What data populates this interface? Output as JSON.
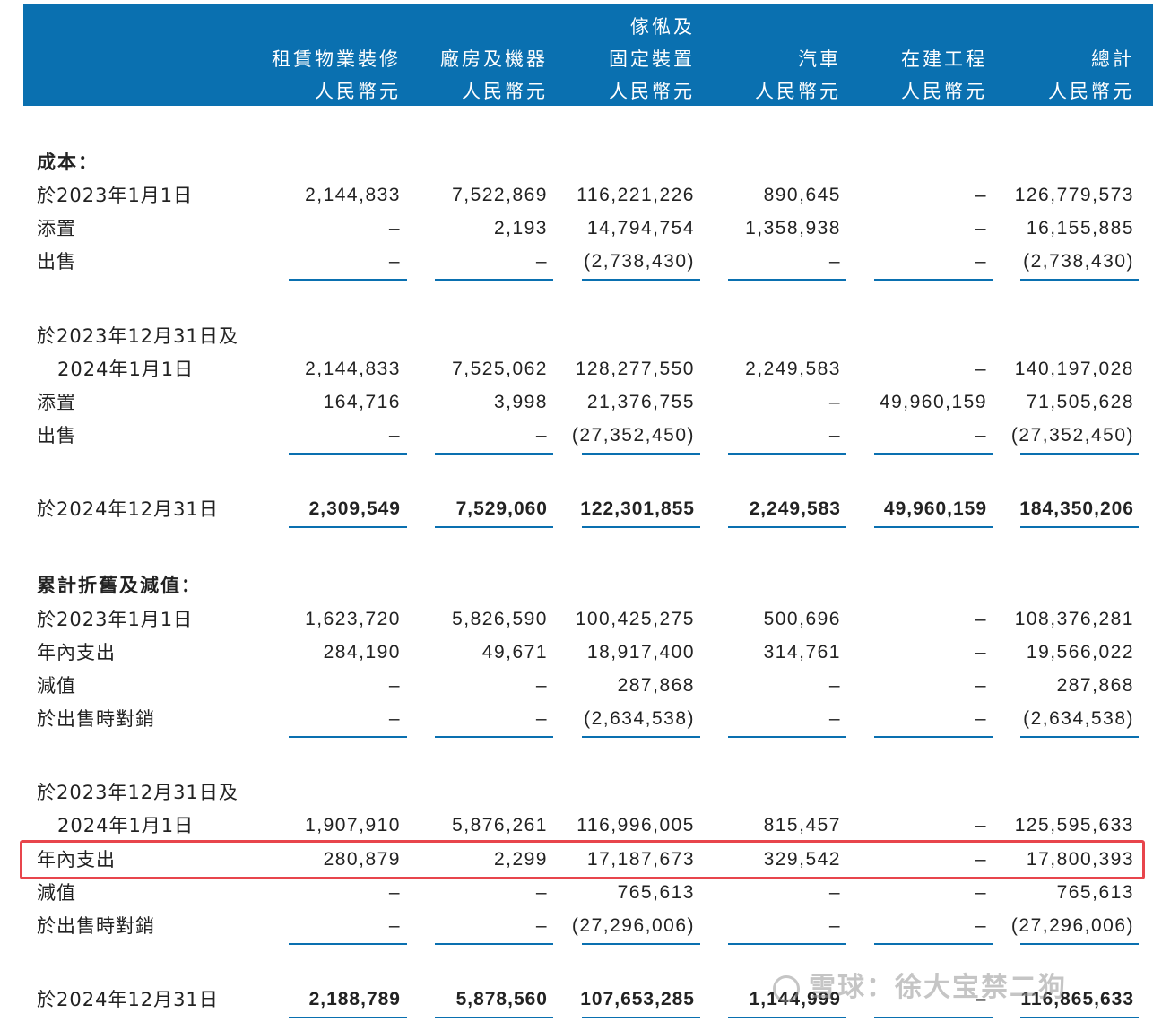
{
  "header": {
    "columns": [
      {
        "lines": [
          "",
          "租賃物業裝修",
          "人民幣元"
        ]
      },
      {
        "lines": [
          "",
          "廠房及機器",
          "人民幣元"
        ]
      },
      {
        "lines": [
          "傢俬及",
          "固定裝置",
          "人民幣元"
        ]
      },
      {
        "lines": [
          "",
          "汽車",
          "人民幣元"
        ]
      },
      {
        "lines": [
          "",
          "在建工程",
          "人民幣元"
        ]
      },
      {
        "lines": [
          "",
          "總計",
          "人民幣元"
        ]
      }
    ]
  },
  "rows": [
    {
      "label": "成本：",
      "type": "section",
      "values": []
    },
    {
      "label": "於2023年1月1日",
      "values": [
        "2,144,833",
        "7,522,869",
        "116,221,226",
        "890,645",
        "–",
        "126,779,573"
      ]
    },
    {
      "label": "添置",
      "values": [
        "–",
        "2,193",
        "14,794,754",
        "1,358,938",
        "–",
        "16,155,885"
      ]
    },
    {
      "label": "出售",
      "values": [
        "–",
        "–",
        "(2,738,430)",
        "–",
        "–",
        "(2,738,430)"
      ]
    },
    {
      "label": "於2023年12月31日及",
      "type": "text",
      "values": []
    },
    {
      "label": "2024年1月1日",
      "type": "indent",
      "values": [
        "2,144,833",
        "7,525,062",
        "128,277,550",
        "2,249,583",
        "–",
        "140,197,028"
      ]
    },
    {
      "label": "添置",
      "values": [
        "164,716",
        "3,998",
        "21,376,755",
        "–",
        "49,960,159",
        "71,505,628"
      ]
    },
    {
      "label": "出售",
      "values": [
        "–",
        "–",
        "(27,352,450)",
        "–",
        "–",
        "(27,352,450)"
      ]
    },
    {
      "label": "於2024年12月31日",
      "type": "total",
      "values": [
        "2,309,549",
        "7,529,060",
        "122,301,855",
        "2,249,583",
        "49,960,159",
        "184,350,206"
      ]
    },
    {
      "label": "累計折舊及減值：",
      "type": "section",
      "values": []
    },
    {
      "label": "於2023年1月1日",
      "values": [
        "1,623,720",
        "5,826,590",
        "100,425,275",
        "500,696",
        "–",
        "108,376,281"
      ]
    },
    {
      "label": "年內支出",
      "values": [
        "284,190",
        "49,671",
        "18,917,400",
        "314,761",
        "–",
        "19,566,022"
      ]
    },
    {
      "label": "減值",
      "values": [
        "–",
        "–",
        "287,868",
        "–",
        "–",
        "287,868"
      ]
    },
    {
      "label": "於出售時對銷",
      "values": [
        "–",
        "–",
        "(2,634,538)",
        "–",
        "–",
        "(2,634,538)"
      ]
    },
    {
      "label": "於2023年12月31日及",
      "type": "text",
      "values": []
    },
    {
      "label": "2024年1月1日",
      "type": "indent",
      "values": [
        "1,907,910",
        "5,876,261",
        "116,996,005",
        "815,457",
        "–",
        "125,595,633"
      ]
    },
    {
      "label": "年內支出",
      "type": "highlighted",
      "values": [
        "280,879",
        "2,299",
        "17,187,673",
        "329,542",
        "–",
        "17,800,393"
      ]
    },
    {
      "label": "減值",
      "values": [
        "–",
        "–",
        "765,613",
        "–",
        "–",
        "765,613"
      ]
    },
    {
      "label": "於出售時對銷",
      "values": [
        "–",
        "–",
        "(27,296,006)",
        "–",
        "–",
        "(27,296,006)"
      ]
    },
    {
      "label": "於2024年12月31日",
      "type": "total",
      "values": [
        "2,188,789",
        "5,878,560",
        "107,653,285",
        "1,144,999",
        "–",
        "116,865,633"
      ]
    }
  ],
  "colors": {
    "header_bg": "#0a70b0",
    "rule": "#0a70b0",
    "highlight_border": "#e8454c"
  },
  "watermark": {
    "text": "雪球：徐大宝禁二狗",
    "icon": "snowball-logo-icon"
  }
}
